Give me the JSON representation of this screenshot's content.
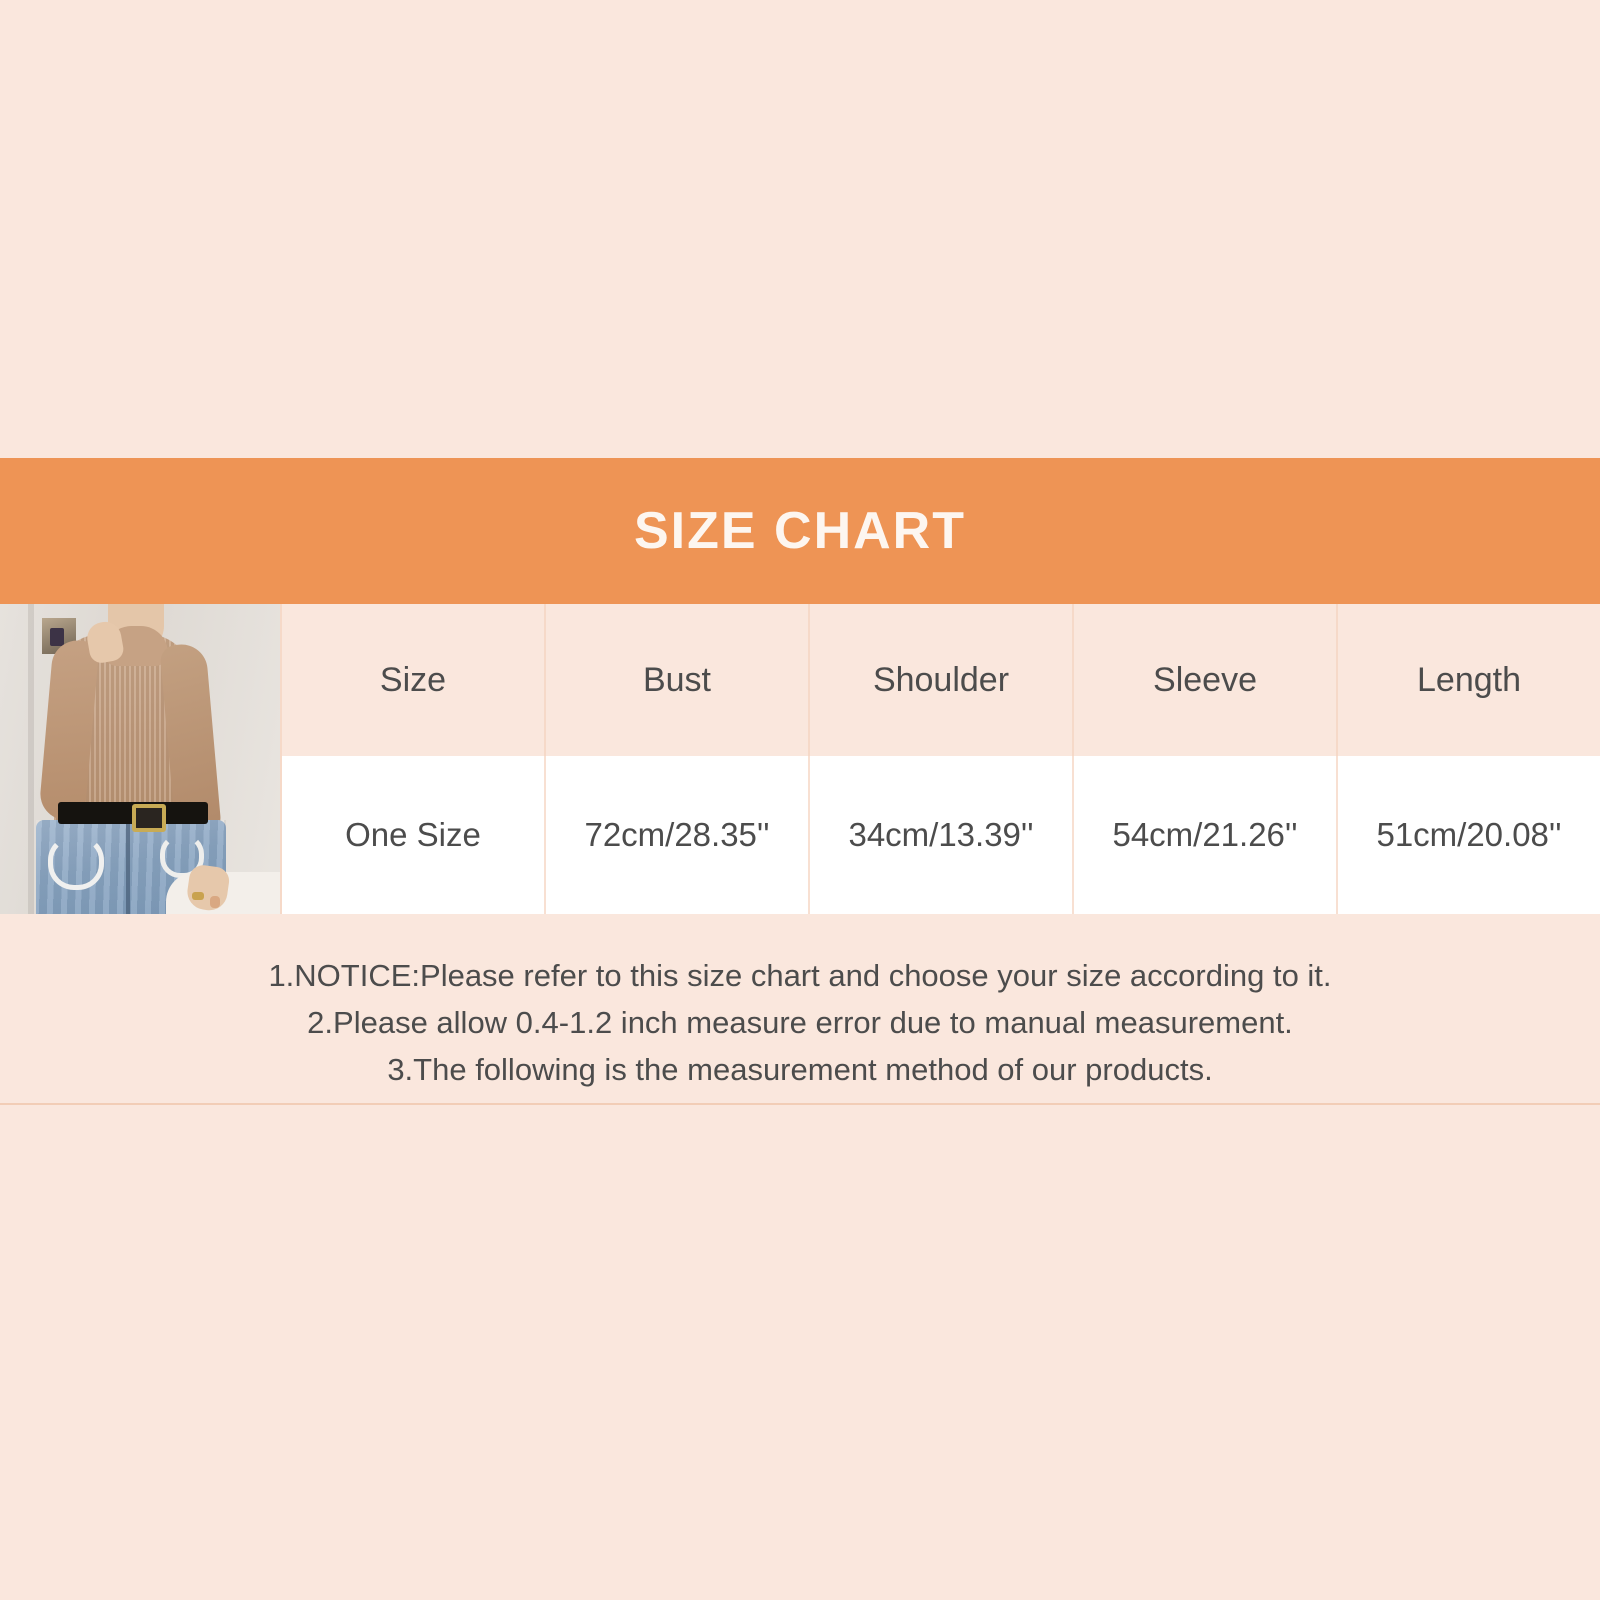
{
  "banner": {
    "title": "SIZE CHART"
  },
  "colors": {
    "banner_background": "#ee9455",
    "page_background": "#fae7dd",
    "header_row_background": "#fae7dd",
    "data_row_background": "#ffffff",
    "text": "#4c4c4c",
    "banner_text": "#fdf6f0",
    "divider": "#f6d9c8"
  },
  "table": {
    "headers": [
      "Size",
      "Bust",
      "Shoulder",
      "Sleeve",
      "Length"
    ],
    "rows": [
      [
        "One Size",
        "72cm/28.35''",
        "34cm/13.39''",
        "54cm/21.26''",
        "51cm/20.08''"
      ]
    ]
  },
  "product_photo": {
    "alt": "woman wearing tan ribbed turtleneck sweater with blue jeans and black belt"
  },
  "notice": {
    "lines": [
      "1.NOTICE:Please refer to this size chart and choose your size according to it.",
      "2.Please allow 0.4-1.2 inch measure error due to manual measurement.",
      "3.The following is the measurement method of our products."
    ]
  }
}
